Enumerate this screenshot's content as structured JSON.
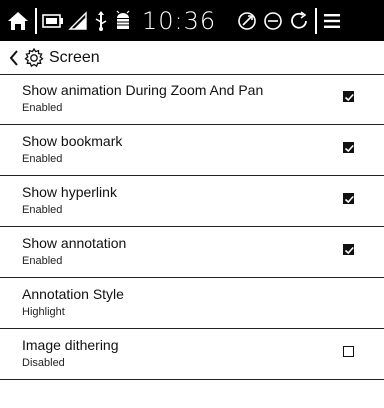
{
  "status_bar": {
    "time": "10:36",
    "icons": [
      "home-icon",
      "battery-icon",
      "wifi-icon",
      "usb-icon",
      "android-icon",
      "sync-icon",
      "minus-circle-icon",
      "refresh-icon",
      "menu-icon"
    ]
  },
  "header": {
    "title": "Screen"
  },
  "settings": [
    {
      "label": "Show animation During Zoom And Pan",
      "status": "Enabled",
      "checked": true
    },
    {
      "label": "Show bookmark",
      "status": "Enabled",
      "checked": true
    },
    {
      "label": "Show hyperlink",
      "status": "Enabled",
      "checked": true
    },
    {
      "label": "Show annotation",
      "status": "Enabled",
      "checked": true
    },
    {
      "label": "Annotation Style",
      "status": "Highlight",
      "checked": null
    },
    {
      "label": "Image dithering",
      "status": "Disabled",
      "checked": false
    }
  ]
}
